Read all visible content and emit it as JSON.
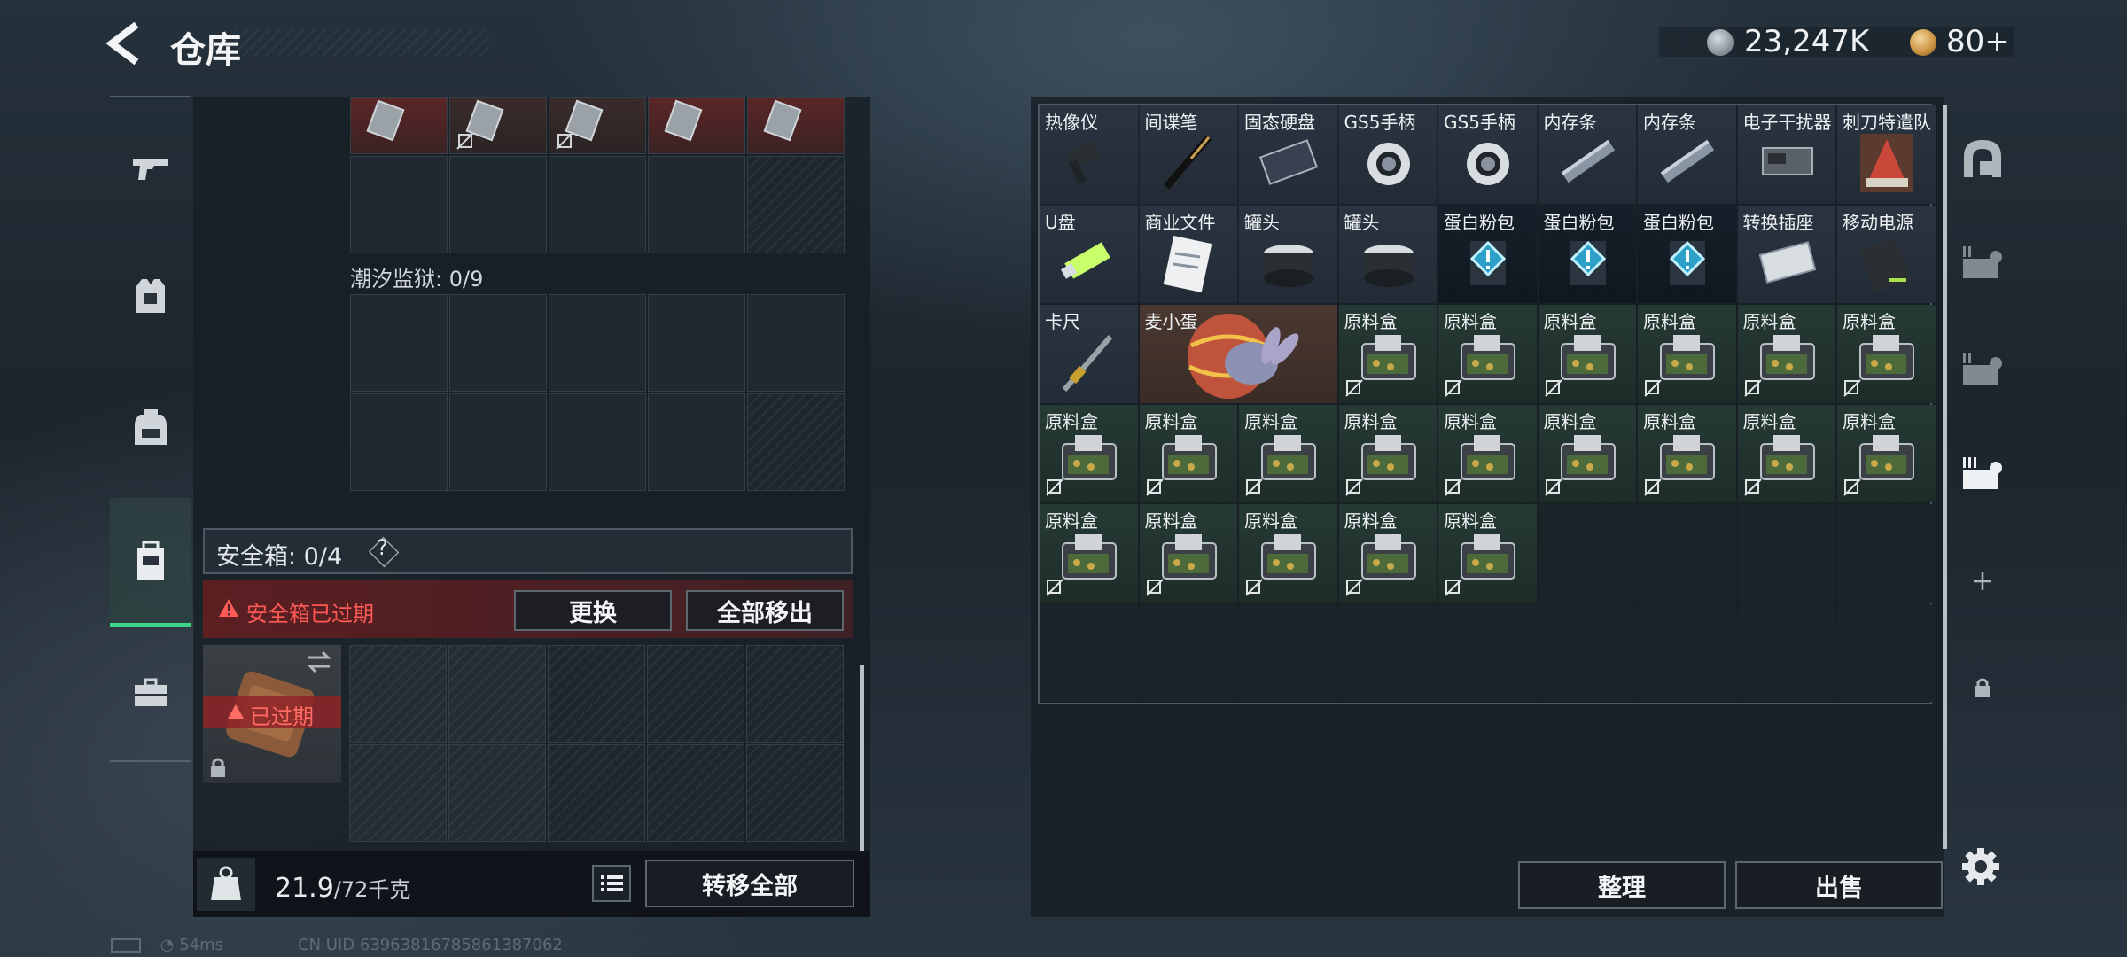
{
  "header": {
    "title": "仓库",
    "back_icon": "back-arrow-icon",
    "currencies": [
      {
        "icon": "silver-coin-icon",
        "value": "23,247K"
      },
      {
        "icon": "gold-coin-icon",
        "value": "80+"
      }
    ]
  },
  "left_nav": [
    {
      "icon": "gun-icon",
      "active": false
    },
    {
      "icon": "armor-vest-icon",
      "active": false
    },
    {
      "icon": "backpack-icon",
      "active": false
    },
    {
      "icon": "safe-case-icon",
      "active": true
    },
    {
      "icon": "briefcase-icon",
      "active": false
    }
  ],
  "loadout": {
    "prison_label": "潮汐监狱: 0/9",
    "safe_box_label": "安全箱: 0/4",
    "help_symbol": "?",
    "expired_warning": "安全箱已过期",
    "replace_button": "更换",
    "move_all_out_button": "全部移出",
    "case_expired_badge": "已过期",
    "weight_current": "21.9",
    "weight_max": "/72千克",
    "transfer_all_button": "转移全部"
  },
  "stash": {
    "items": [
      {
        "name": "热像仪",
        "icon": "thermal-imager-icon",
        "style": "normal"
      },
      {
        "name": "间谍笔",
        "icon": "spy-pen-icon",
        "style": "normal"
      },
      {
        "name": "固态硬盘",
        "icon": "ssd-icon",
        "style": "normal"
      },
      {
        "name": "GS5手柄",
        "icon": "gamepad-icon",
        "style": "normal"
      },
      {
        "name": "GS5手柄",
        "icon": "gamepad-icon",
        "style": "normal"
      },
      {
        "name": "内存条",
        "icon": "ram-stick-icon",
        "style": "normal"
      },
      {
        "name": "内存条",
        "icon": "ram-stick-icon",
        "style": "normal"
      },
      {
        "name": "电子干扰器",
        "icon": "jammer-icon",
        "style": "normal"
      },
      {
        "name": "刺刀特遣队",
        "icon": "poster-icon",
        "style": "normal"
      },
      {
        "name": "U盘",
        "icon": "usb-drive-icon",
        "style": "normal"
      },
      {
        "name": "商业文件",
        "icon": "document-icon",
        "style": "normal"
      },
      {
        "name": "罐头",
        "icon": "can-icon",
        "style": "normal"
      },
      {
        "name": "罐头",
        "icon": "can-icon",
        "style": "normal"
      },
      {
        "name": "蛋白粉包",
        "icon": "protein-pack-icon",
        "style": "dark"
      },
      {
        "name": "蛋白粉包",
        "icon": "protein-pack-icon",
        "style": "dark"
      },
      {
        "name": "蛋白粉包",
        "icon": "protein-pack-icon",
        "style": "dark"
      },
      {
        "name": "转换插座",
        "icon": "power-adapter-icon",
        "style": "normal"
      },
      {
        "name": "移动电源",
        "icon": "power-bank-icon",
        "style": "normal"
      },
      {
        "name": "卡尺",
        "icon": "caliper-icon",
        "style": "normal"
      },
      {
        "name": "麦小蛋",
        "icon": "plush-egg-icon",
        "style": "pink"
      }
    ],
    "material_box_label": "原料盒",
    "material_box_count": 20,
    "tidy_button": "整理",
    "sell_button": "出售"
  },
  "right_nav": [
    {
      "icon": "helmet-icon"
    },
    {
      "icon": "stash-tab-1-icon"
    },
    {
      "icon": "stash-tab-2-icon"
    },
    {
      "icon": "stash-tab-3-icon"
    },
    {
      "icon": "add-tab-icon"
    },
    {
      "icon": "lock-tab-icon"
    }
  ],
  "status": {
    "ping": "54ms",
    "uid": "CN UID 6396381678586138​7062"
  },
  "colors": {
    "accent_green": "#3bd387",
    "warning_red": "#ff5a55",
    "panel_bg": "#171e24"
  }
}
